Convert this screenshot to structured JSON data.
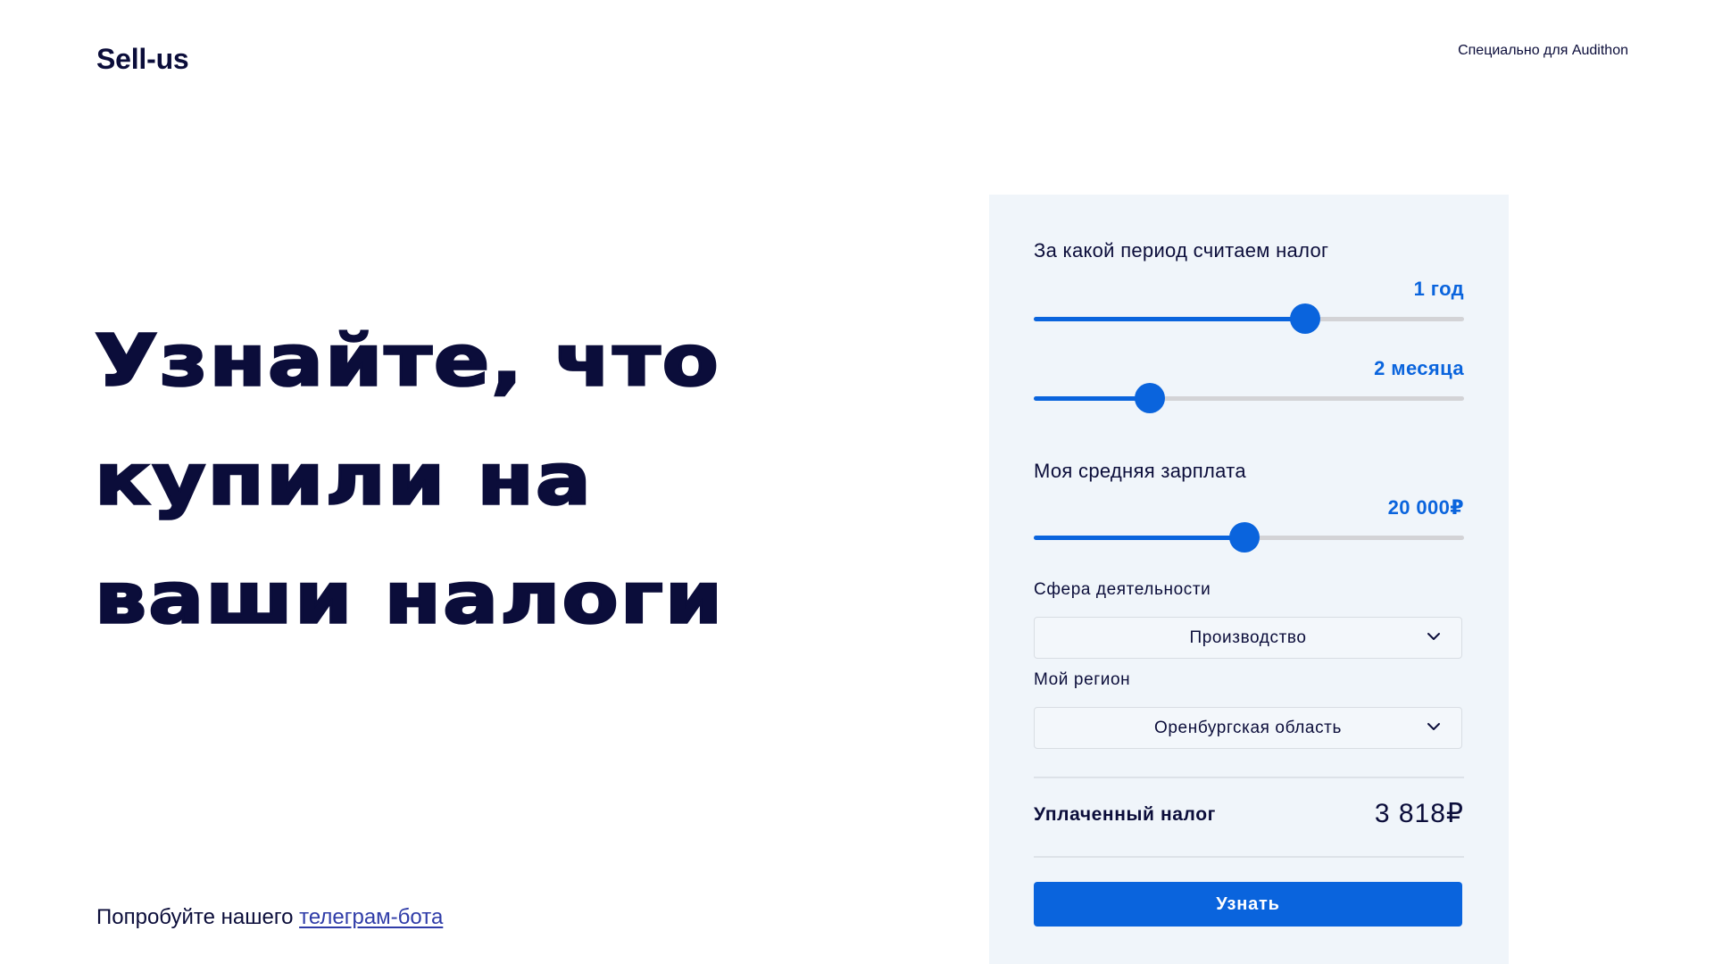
{
  "header": {
    "logo": "Sell-us",
    "note": "Специально для Audithon"
  },
  "hero": {
    "lines": [
      "Узнайте, что",
      "купили на",
      "ваши налоги"
    ]
  },
  "footer": {
    "prefix": "Попробуйте нашего ",
    "link_text": "телеграм-бота"
  },
  "calculator": {
    "period": {
      "label": "За какой период считаем налог",
      "years_value": "1 год",
      "years_fraction": 0.63,
      "months_value": "2 месяца",
      "months_fraction": 0.27
    },
    "salary": {
      "label": "Моя средняя зарплата",
      "value": "20 000₽",
      "fraction": 0.49
    },
    "sphere": {
      "label": "Сфера деятельности",
      "selected": "Производство"
    },
    "region": {
      "label": "Мой регион",
      "selected": "Оренбургская область"
    },
    "result": {
      "label": "Уплаченный налог",
      "value": "3 818₽"
    },
    "submit_label": "Узнать"
  },
  "colors": {
    "accent": "#0a64dd",
    "text": "#0b0d3a",
    "panel_bg": "#f0f5fa",
    "track": "#d3d3d6"
  },
  "icons": {
    "select_chevron": "chevron-down-icon"
  }
}
